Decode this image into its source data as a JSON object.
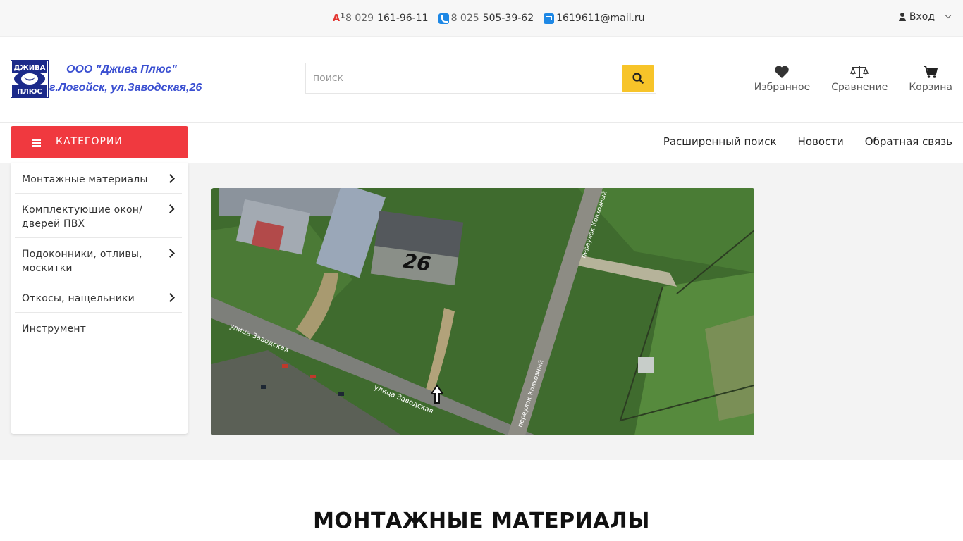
{
  "topbar": {
    "contacts": [
      {
        "icon": "a1-icon",
        "prefix": "8 029",
        "number": "161-96-11"
      },
      {
        "icon": "phone-icon",
        "prefix": "8 025",
        "number": "505-39-62"
      },
      {
        "icon": "mail-icon",
        "prefix": "",
        "number": "1619611@mail.ru"
      }
    ],
    "a1_label": "A1",
    "login_label": "Вход"
  },
  "header": {
    "company_line1": "ООО \"Джива Плюс\"",
    "company_line2": "г.Логойск, ул.Заводская,26",
    "logo_text_top": "ДЖИВА",
    "logo_text_bottom": "ПЛЮС",
    "search_placeholder": "поиск",
    "actions": [
      {
        "icon": "heart-icon",
        "label": "Избранное"
      },
      {
        "icon": "scales-icon",
        "label": "Сравнение"
      },
      {
        "icon": "cart-icon",
        "label": "Корзина"
      }
    ]
  },
  "nav": {
    "categories_label": "КАТЕГОРИИ",
    "links": [
      "Расширенный поиск",
      "Новости",
      "Обратная связь"
    ]
  },
  "categories": [
    {
      "label": "Монтажные материалы",
      "has_children": true
    },
    {
      "label": "Комплектующие окон/ дверей ПВХ",
      "has_children": true
    },
    {
      "label": "Подоконники, отливы, москитки",
      "has_children": true
    },
    {
      "label": "Откосы, нащельники",
      "has_children": true
    },
    {
      "label": "Инструмент",
      "has_children": false
    }
  ],
  "map": {
    "building_number": "26",
    "street_label_1": "улица Заводская",
    "street_label_2": "улица Заводская",
    "lane_label_1": "переулок Колхозный",
    "lane_label_2": "переулок Колхозный"
  },
  "section_title": "МОНТАЖНЫЕ МАТЕРИАЛЫ",
  "colors": {
    "accent_red": "#f0393f",
    "search_yellow": "#f7c429",
    "company_blue": "#3a4fd1"
  }
}
